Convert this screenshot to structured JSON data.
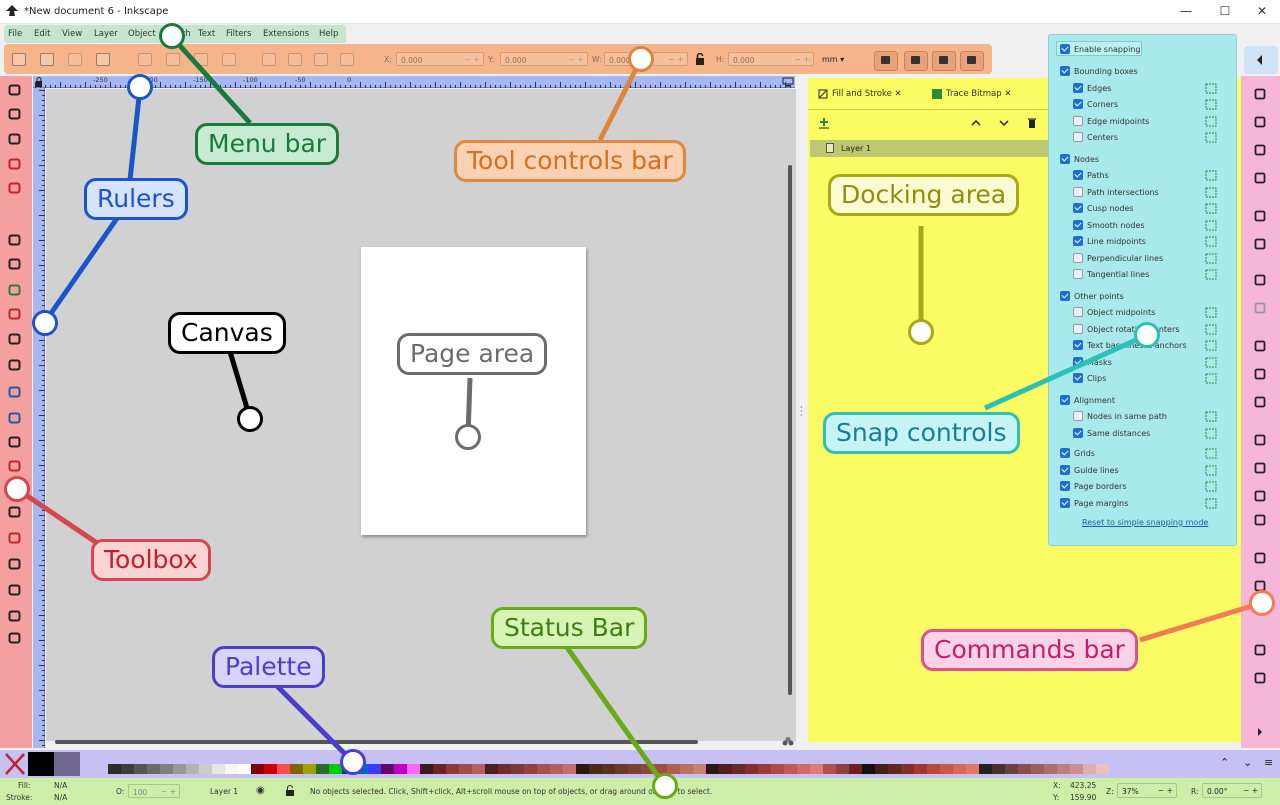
{
  "window": {
    "title": "*New document 6 - Inkscape",
    "min": "—",
    "max": "☐",
    "close": "✕"
  },
  "menu": [
    "File",
    "Edit",
    "View",
    "Layer",
    "Object",
    "Path",
    "Text",
    "Filters",
    "Extensions",
    "Help"
  ],
  "toolctl": {
    "x_label": "X:",
    "x_value": "0.000",
    "y_label": "Y:",
    "y_value": "0.000",
    "w_label": "W:",
    "w_value": "0.000",
    "h_label": "H:",
    "h_value": "0.000",
    "unit": "mm ▾"
  },
  "ruler_numbers": [
    "-250",
    "-200",
    "-150",
    "-100",
    "-50",
    "0"
  ],
  "dock": {
    "tabs": [
      "Fill and Stroke",
      "Trace Bitmap"
    ],
    "tab_close": "✕",
    "layer": "Layer 1"
  },
  "snap": {
    "enable": "Enable snapping",
    "groups": [
      {
        "label": "Bounding boxes",
        "items": [
          {
            "label": "Edges",
            "on": true
          },
          {
            "label": "Corners",
            "on": true
          },
          {
            "label": "Edge midpoints",
            "on": false
          },
          {
            "label": "Centers",
            "on": false
          }
        ]
      },
      {
        "label": "Nodes",
        "items": [
          {
            "label": "Paths",
            "on": true
          },
          {
            "label": "Path intersections",
            "on": false
          },
          {
            "label": "Cusp nodes",
            "on": true
          },
          {
            "label": "Smooth nodes",
            "on": true
          },
          {
            "label": "Line midpoints",
            "on": true
          },
          {
            "label": "Perpendicular lines",
            "on": false
          },
          {
            "label": "Tangential lines",
            "on": false
          }
        ]
      },
      {
        "label": "Other points",
        "items": [
          {
            "label": "Object midpoints",
            "on": false
          },
          {
            "label": "Object rotation centers",
            "on": false
          },
          {
            "label": "Text baselines & anchors",
            "on": true
          },
          {
            "label": "Masks",
            "on": true
          },
          {
            "label": "Clips",
            "on": true
          }
        ]
      },
      {
        "label": "Alignment",
        "items": [
          {
            "label": "Nodes in same path",
            "on": false
          },
          {
            "label": "Same distances",
            "on": true
          }
        ]
      }
    ],
    "extra": [
      {
        "label": "Grids",
        "on": true
      },
      {
        "label": "Guide lines",
        "on": true
      },
      {
        "label": "Page borders",
        "on": true
      },
      {
        "label": "Page margins",
        "on": true
      }
    ],
    "reset": "Reset to simple snapping mode"
  },
  "status": {
    "fill_label": "Fill:",
    "fill_value": "N/A",
    "stroke_label": "Stroke:",
    "stroke_value": "N/A",
    "opacity_label": "O:",
    "opacity_value": "100",
    "layer": "Layer 1",
    "message": "No objects selected. Click, Shift+click, Alt+scroll mouse on top of objects, or drag around objects to select.",
    "x_label": "X:",
    "x_value": "423.25",
    "y_label": "Y:",
    "y_value": "159.90",
    "zoom_label": "Z:",
    "zoom_value": "37%",
    "rot_label": "R:",
    "rot_value": "0.00°"
  },
  "callouts": {
    "menubar": "Menu bar",
    "toolctl": "Tool controls bar",
    "rulers": "Rulers",
    "docking": "Docking area",
    "canvas": "Canvas",
    "page": "Page area",
    "snap": "Snap controls",
    "toolbox": "Toolbox",
    "status": "Status Bar",
    "palette": "Palette",
    "commands": "Commands bar"
  },
  "colors": {
    "menubar": "#c5e5cf",
    "toolctl": "#f6b48a",
    "toolbox": "#f4a0a0",
    "rulers": "#a7b7f2",
    "dock": "#fbfb63",
    "snap": "#a8eaeb",
    "commands": "#f6b6d8",
    "palette": "#c7c1f3",
    "status": "#cceea6"
  }
}
